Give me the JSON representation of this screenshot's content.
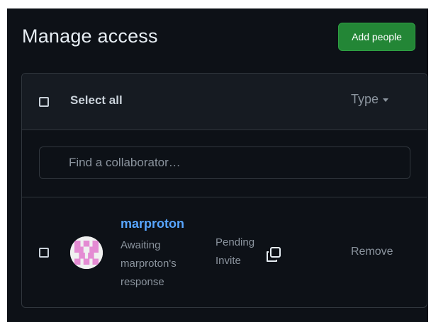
{
  "page": {
    "title": "Manage access",
    "add_people_label": "Add people"
  },
  "header": {
    "select_all_label": "Select all",
    "type_filter_label": "Type"
  },
  "search": {
    "placeholder": "Find a collaborator…",
    "icon": "search-icon"
  },
  "collaborators": [
    {
      "username": "marproton",
      "status_text": "Awaiting marproton's response",
      "invite_state": "Pending Invite",
      "copy_icon": "copy-icon",
      "remove_label": "Remove"
    }
  ],
  "colors": {
    "background": "#0d1117",
    "header_bg": "#161b22",
    "border": "#30363d",
    "accent_green": "#238636",
    "link_blue": "#58a6ff",
    "muted_text": "#8b949e",
    "avatar_pink": "#e48bd3"
  }
}
